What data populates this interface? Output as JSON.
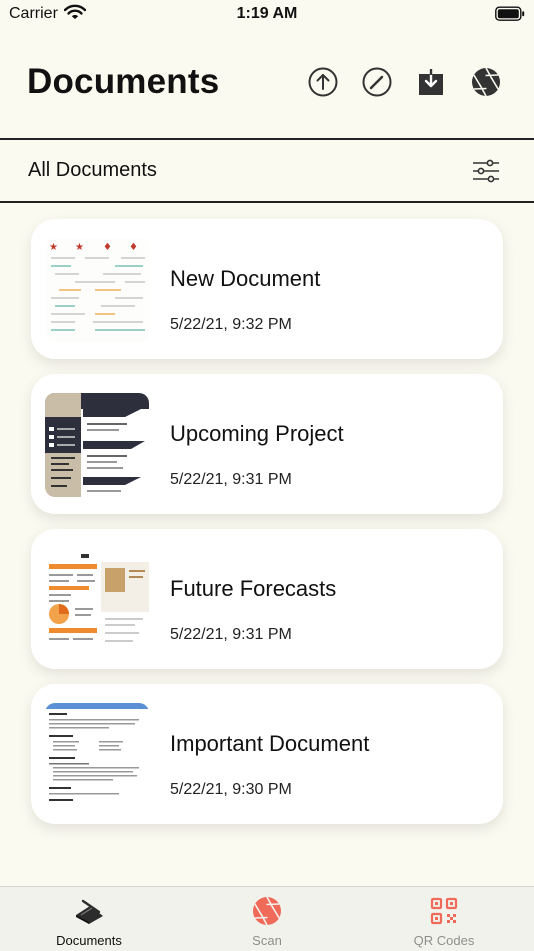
{
  "status_bar": {
    "carrier": "Carrier",
    "time": "1:19 AM"
  },
  "header": {
    "title": "Documents",
    "actions": [
      "upload-icon",
      "edit-icon",
      "download-icon",
      "camera-aperture-icon"
    ]
  },
  "section": {
    "title": "All Documents",
    "filter_icon": "sliders-icon"
  },
  "documents": [
    {
      "name": "New Document",
      "date": "5/22/21, 9:32 PM"
    },
    {
      "name": "Upcoming Project",
      "date": "5/22/21, 9:31 PM"
    },
    {
      "name": "Future Forecasts",
      "date": "5/22/21, 9:31 PM"
    },
    {
      "name": "Important Document",
      "date": "5/22/21, 9:30 PM"
    }
  ],
  "tabs": [
    {
      "label": "Documents",
      "icon": "scanner-icon",
      "active": true
    },
    {
      "label": "Scan",
      "icon": "aperture-icon",
      "active": false
    },
    {
      "label": "QR Codes",
      "icon": "qr-code-icon",
      "active": false
    }
  ],
  "colors": {
    "background": "#fbfaf1",
    "accent": "#f06a5a",
    "inactive_tab": "#8e8e8e"
  }
}
